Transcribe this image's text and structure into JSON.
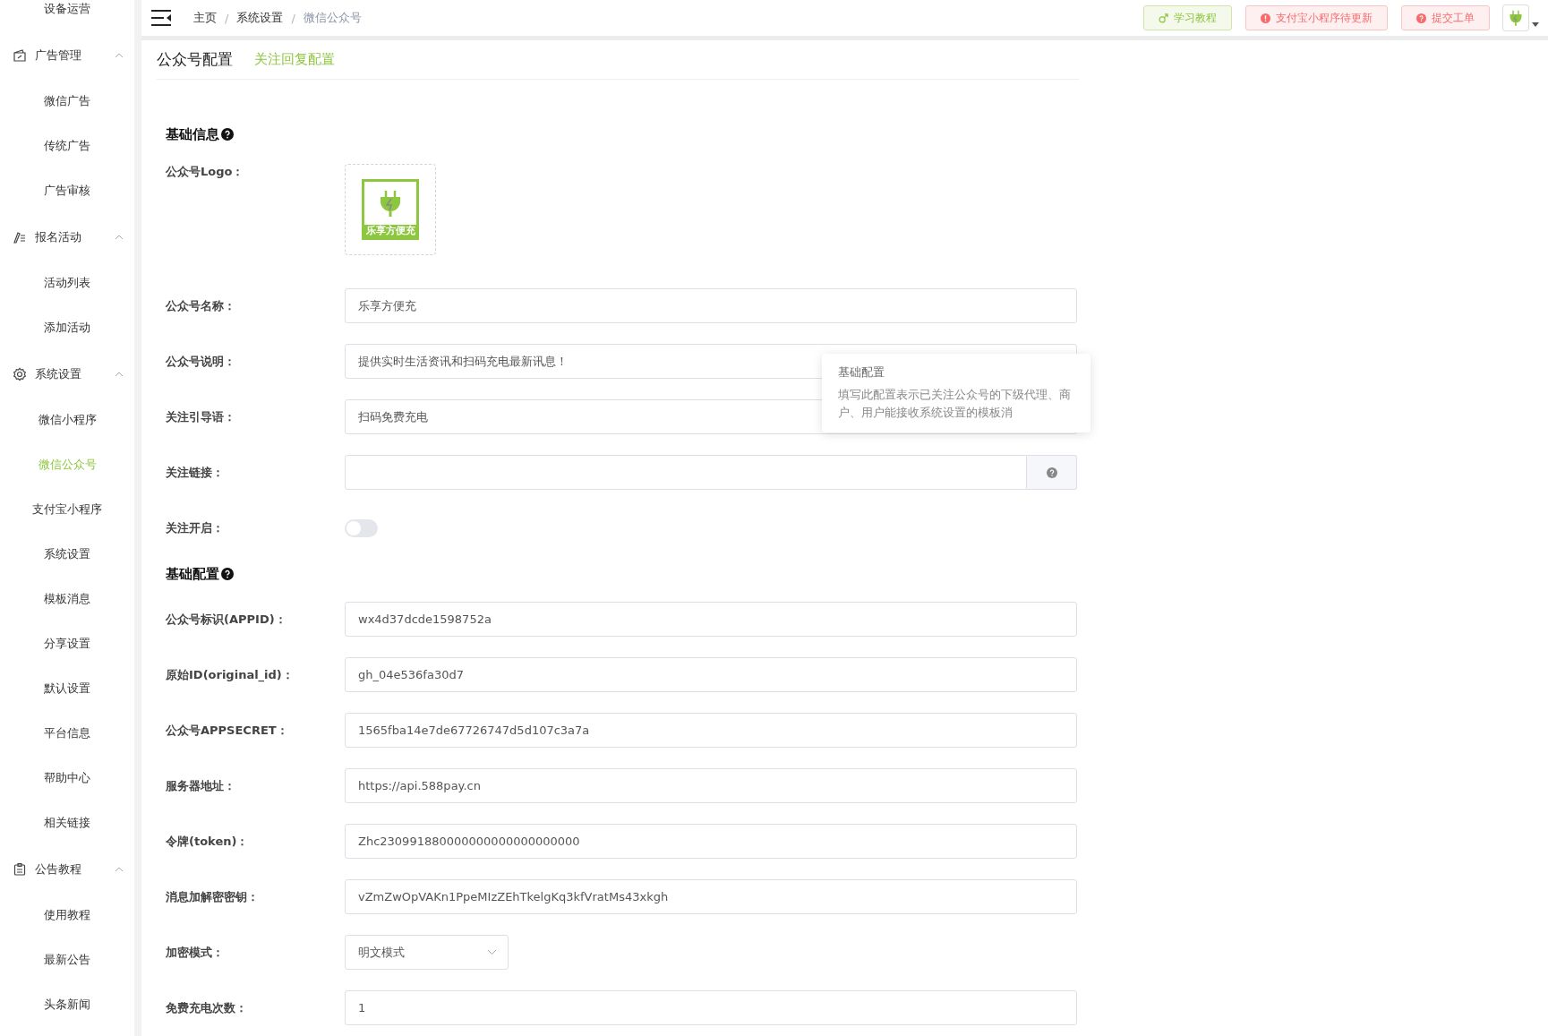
{
  "sidebar": {
    "items": [
      {
        "kind": "item",
        "label": "设备运营",
        "selected": false
      },
      {
        "kind": "group",
        "label": "广告管理",
        "expanded": true,
        "children": [
          {
            "label": "微信广告",
            "selected": false
          },
          {
            "label": "传统广告",
            "selected": false
          },
          {
            "label": "广告审核",
            "selected": false
          }
        ]
      },
      {
        "kind": "group",
        "label": "报名活动",
        "expanded": true,
        "children": [
          {
            "label": "活动列表",
            "selected": false
          },
          {
            "label": "添加活动",
            "selected": false
          }
        ]
      },
      {
        "kind": "group",
        "label": "系统设置",
        "expanded": true,
        "children": [
          {
            "label": "微信小程序",
            "selected": false
          },
          {
            "label": "微信公众号",
            "selected": true
          },
          {
            "label": "支付宝小程序",
            "selected": false
          },
          {
            "label": "系统设置",
            "selected": false
          },
          {
            "label": "模板消息",
            "selected": false
          },
          {
            "label": "分享设置",
            "selected": false
          },
          {
            "label": "默认设置",
            "selected": false
          },
          {
            "label": "平台信息",
            "selected": false
          },
          {
            "label": "帮助中心",
            "selected": false
          },
          {
            "label": "相关链接",
            "selected": false
          }
        ]
      },
      {
        "kind": "group",
        "label": "公告教程",
        "expanded": true,
        "children": [
          {
            "label": "使用教程",
            "selected": false
          },
          {
            "label": "最新公告",
            "selected": false
          },
          {
            "label": "头条新闻",
            "selected": false
          }
        ]
      }
    ]
  },
  "topbar": {
    "breadcrumb": [
      "主页",
      "系统设置",
      "微信公众号"
    ],
    "separator": "/",
    "buttons": [
      {
        "label": "学习教程",
        "kind": "tutorial"
      },
      {
        "label": "支付宝小程序待更新",
        "kind": "alert"
      },
      {
        "label": "提交工单",
        "kind": "ticket"
      }
    ]
  },
  "tabs": [
    {
      "label": "公众号配置",
      "selected": true
    },
    {
      "label": "关注回复配置",
      "selected": false
    }
  ],
  "sections": [
    {
      "title": "基础信息",
      "fields": [
        {
          "kind": "logo",
          "label": "公众号Logo：",
          "caption": "乐享方便充"
        },
        {
          "kind": "text",
          "label": "公众号名称：",
          "value": "乐享方便充"
        },
        {
          "kind": "text",
          "label": "公众号说明：",
          "value": "提供实时生活资讯和扫码充电最新讯息！"
        },
        {
          "kind": "text",
          "label": "关注引导语：",
          "value": "扫码免费充电"
        },
        {
          "kind": "addon",
          "label": "关注链接："
        },
        {
          "kind": "switch",
          "label": "关注开启：",
          "on": false
        }
      ]
    },
    {
      "title": "基础配置",
      "fields": [
        {
          "kind": "text",
          "label": "公众号标识(APPID)：",
          "value": "wx4d37dcde1598752a"
        },
        {
          "kind": "text",
          "label": "原始ID(original_id)：",
          "value": "gh_04e536fa30d7"
        },
        {
          "kind": "text",
          "label": "公众号APPSECRET：",
          "value": "1565fba14e7de67726747d5d107c3a7a"
        },
        {
          "kind": "text",
          "label": "服务器地址：",
          "value": "https://api.588pay.cn"
        },
        {
          "kind": "text",
          "label": "令牌(token)：",
          "value": "Zhc230991880000000000000000000"
        },
        {
          "kind": "text",
          "label": "消息加解密密钥：",
          "value": "vZmZwOpVAKn1PpeMIzZEhTkelgKq3kfVratMs43xkgh"
        },
        {
          "kind": "select",
          "label": "加密模式：",
          "value": "明文模式"
        },
        {
          "kind": "text",
          "label": "免费充电次数：",
          "value": "1"
        }
      ]
    }
  ],
  "tooltip": {
    "title": "基础配置",
    "text": "填写此配置表示已关注公众号的下级代理、商户、用户能接收系统设置的模板消"
  }
}
